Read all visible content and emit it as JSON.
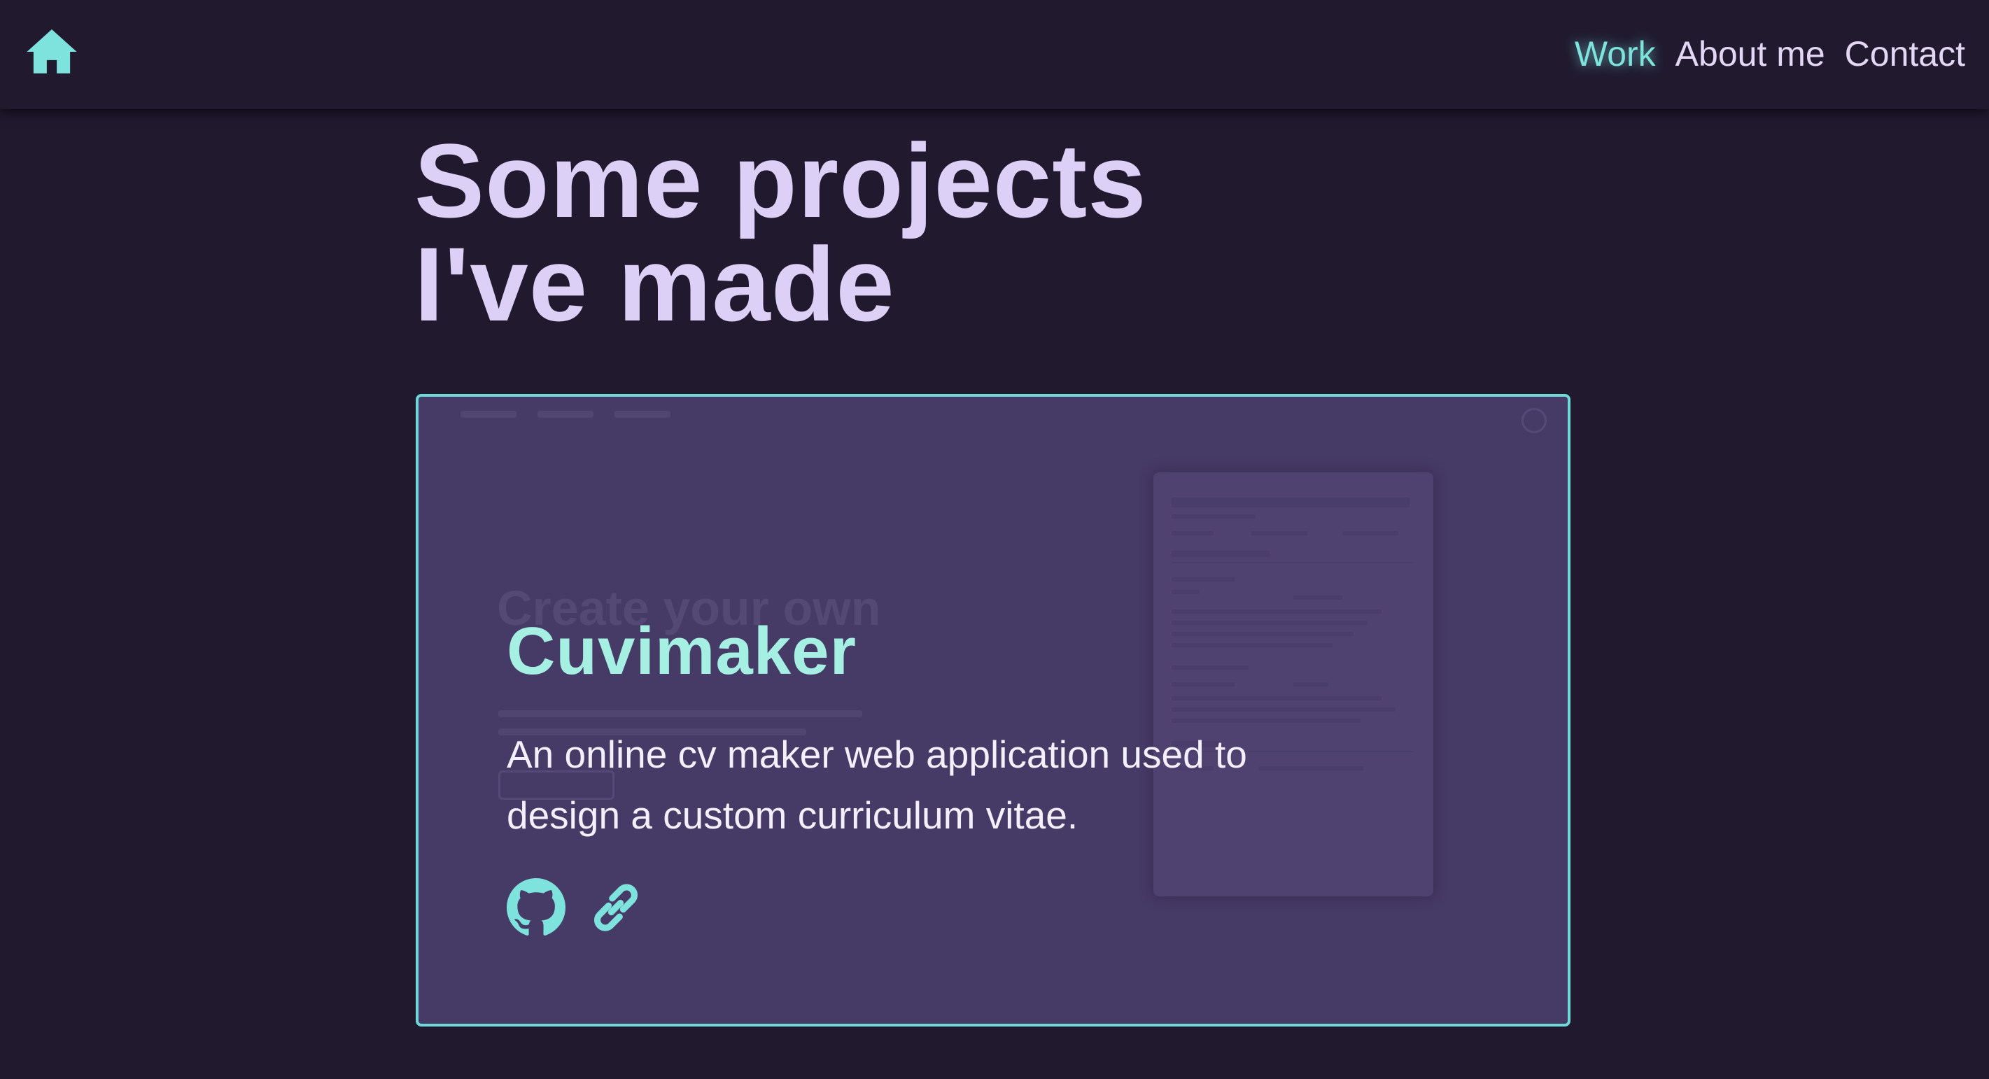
{
  "nav": {
    "home_icon": "home-icon",
    "links": [
      {
        "label": "Work",
        "active": true
      },
      {
        "label": "About me",
        "active": false
      },
      {
        "label": "Contact",
        "active": false
      }
    ]
  },
  "page": {
    "heading_line1": "Some projects",
    "heading_line2": "I've made"
  },
  "project": {
    "title": "Cuvimaker",
    "description": "An online cv maker web application used to design a custom curriculum vitae.",
    "links": [
      {
        "icon": "github-icon"
      },
      {
        "icon": "link-icon"
      }
    ]
  },
  "colors": {
    "background": "#211a2f",
    "accent": "#7ee3dc",
    "heading": "#ddd0f7",
    "card": "#463a66",
    "card_border": "#6fd9d8",
    "title": "#a6f0e3"
  }
}
